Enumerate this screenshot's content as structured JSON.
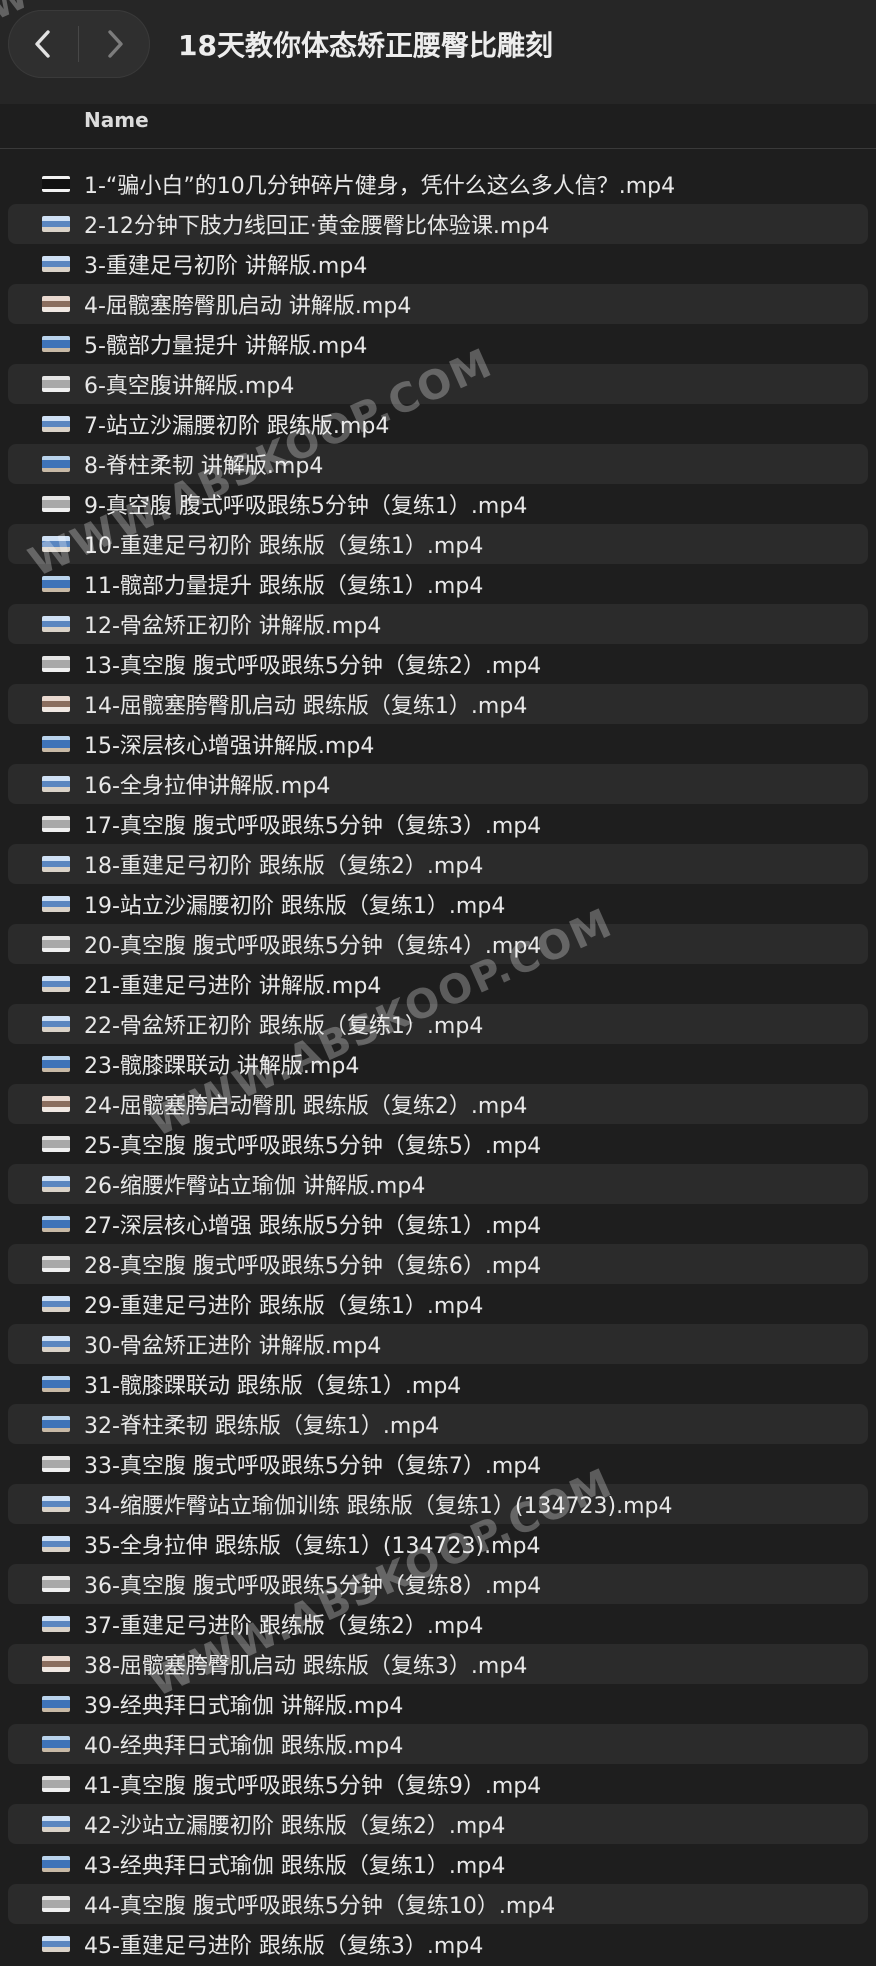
{
  "window": {
    "title": "18天教你体态矫正腰臀比雕刻",
    "back_icon": "chevron-left-icon",
    "forward_icon": "chevron-right-icon"
  },
  "list": {
    "column_header": "Name",
    "files": [
      {
        "name": "1-“骗小白”的10几分钟碎片健身，凭什么这么多人信？.mp4",
        "thumb": "dark"
      },
      {
        "name": "2-12分钟下肢力线回正·黄金腰臀比体验课.mp4",
        "thumb": "video-a"
      },
      {
        "name": "3-重建足弓初阶 讲解版.mp4",
        "thumb": "video-a"
      },
      {
        "name": "4-屈髋塞胯臀肌启动 讲解版.mp4",
        "thumb": "video-d"
      },
      {
        "name": "5-髋部力量提升 讲解版.mp4",
        "thumb": "video-c"
      },
      {
        "name": "6-真空腹讲解版.mp4",
        "thumb": "video-b"
      },
      {
        "name": "7-站立沙漏腰初阶 跟练版.mp4",
        "thumb": "video-a"
      },
      {
        "name": "8-脊柱柔韧 讲解版.mp4",
        "thumb": "video-c"
      },
      {
        "name": "9-真空腹 腹式呼吸跟练5分钟（复练1）.mp4",
        "thumb": "video-b"
      },
      {
        "name": "10-重建足弓初阶 跟练版（复练1）.mp4",
        "thumb": "video-a"
      },
      {
        "name": "11-髋部力量提升 跟练版（复练1）.mp4",
        "thumb": "video-c"
      },
      {
        "name": "12-骨盆矫正初阶 讲解版.mp4",
        "thumb": "video-a"
      },
      {
        "name": "13-真空腹 腹式呼吸跟练5分钟（复练2）.mp4",
        "thumb": "video-b"
      },
      {
        "name": "14-屈髋塞胯臀肌启动 跟练版（复练1）.mp4",
        "thumb": "video-d"
      },
      {
        "name": "15-深层核心增强讲解版.mp4",
        "thumb": "video-c"
      },
      {
        "name": "16-全身拉伸讲解版.mp4",
        "thumb": "video-a"
      },
      {
        "name": "17-真空腹 腹式呼吸跟练5分钟（复练3）.mp4",
        "thumb": "video-b"
      },
      {
        "name": "18-重建足弓初阶 跟练版（复练2）.mp4",
        "thumb": "video-a"
      },
      {
        "name": "19-站立沙漏腰初阶 跟练版（复练1）.mp4",
        "thumb": "video-a"
      },
      {
        "name": "20-真空腹 腹式呼吸跟练5分钟（复练4）.mp4",
        "thumb": "video-b"
      },
      {
        "name": "21-重建足弓进阶 讲解版.mp4",
        "thumb": "video-a"
      },
      {
        "name": "22-骨盆矫正初阶 跟练版（复练1）.mp4",
        "thumb": "video-a"
      },
      {
        "name": "23-髋膝踝联动 讲解版.mp4",
        "thumb": "video-c"
      },
      {
        "name": "24-屈髋塞胯启动臀肌 跟练版（复练2）.mp4",
        "thumb": "video-d"
      },
      {
        "name": "25-真空腹 腹式呼吸跟练5分钟（复练5）.mp4",
        "thumb": "video-b"
      },
      {
        "name": "26-缩腰炸臀站立瑜伽 讲解版.mp4",
        "thumb": "video-a"
      },
      {
        "name": "27-深层核心增强 跟练版5分钟（复练1）.mp4",
        "thumb": "video-c"
      },
      {
        "name": "28-真空腹 腹式呼吸跟练5分钟（复练6）.mp4",
        "thumb": "video-b"
      },
      {
        "name": "29-重建足弓进阶 跟练版（复练1）.mp4",
        "thumb": "video-a"
      },
      {
        "name": "30-骨盆矫正进阶 讲解版.mp4",
        "thumb": "video-a"
      },
      {
        "name": "31-髋膝踝联动 跟练版（复练1）.mp4",
        "thumb": "video-c"
      },
      {
        "name": "32-脊柱柔韧 跟练版（复练1）.mp4",
        "thumb": "video-c"
      },
      {
        "name": "33-真空腹 腹式呼吸跟练5分钟（复练7）.mp4",
        "thumb": "video-b"
      },
      {
        "name": "34-缩腰炸臀站立瑜伽训练 跟练版（复练1）(134723).mp4",
        "thumb": "video-a"
      },
      {
        "name": "35-全身拉伸 跟练版（复练1）(134723).mp4",
        "thumb": "video-a"
      },
      {
        "name": "36-真空腹 腹式呼吸跟练5分钟（复练8）.mp4",
        "thumb": "video-b"
      },
      {
        "name": "37-重建足弓进阶 跟练版（复练2）.mp4",
        "thumb": "video-a"
      },
      {
        "name": "38-屈髋塞胯臀肌启动 跟练版（复练3）.mp4",
        "thumb": "video-d"
      },
      {
        "name": "39-经典拜日式瑜伽 讲解版.mp4",
        "thumb": "video-c"
      },
      {
        "name": "40-经典拜日式瑜伽 跟练版.mp4",
        "thumb": "video-c"
      },
      {
        "name": "41-真空腹 腹式呼吸跟练5分钟（复练9）.mp4",
        "thumb": "video-b"
      },
      {
        "name": "42-沙站立漏腰初阶 跟练版（复练2）.mp4",
        "thumb": "video-a"
      },
      {
        "name": "43-经典拜日式瑜伽 跟练版（复练1）.mp4",
        "thumb": "video-c"
      },
      {
        "name": "44-真空腹 腹式呼吸跟练5分钟（复练10）.mp4",
        "thumb": "video-b"
      },
      {
        "name": "45-重建足弓进阶 跟练版（复练3）.mp4",
        "thumb": "video-a"
      }
    ]
  },
  "watermark": {
    "text": "WWW.ABSKOOP.COM",
    "top_fragment": "W"
  },
  "colors": {
    "background": "#1e1e1e",
    "toolbar": "#262626",
    "alt_row": "#2b2b2b",
    "text": "#e8e8e8"
  }
}
